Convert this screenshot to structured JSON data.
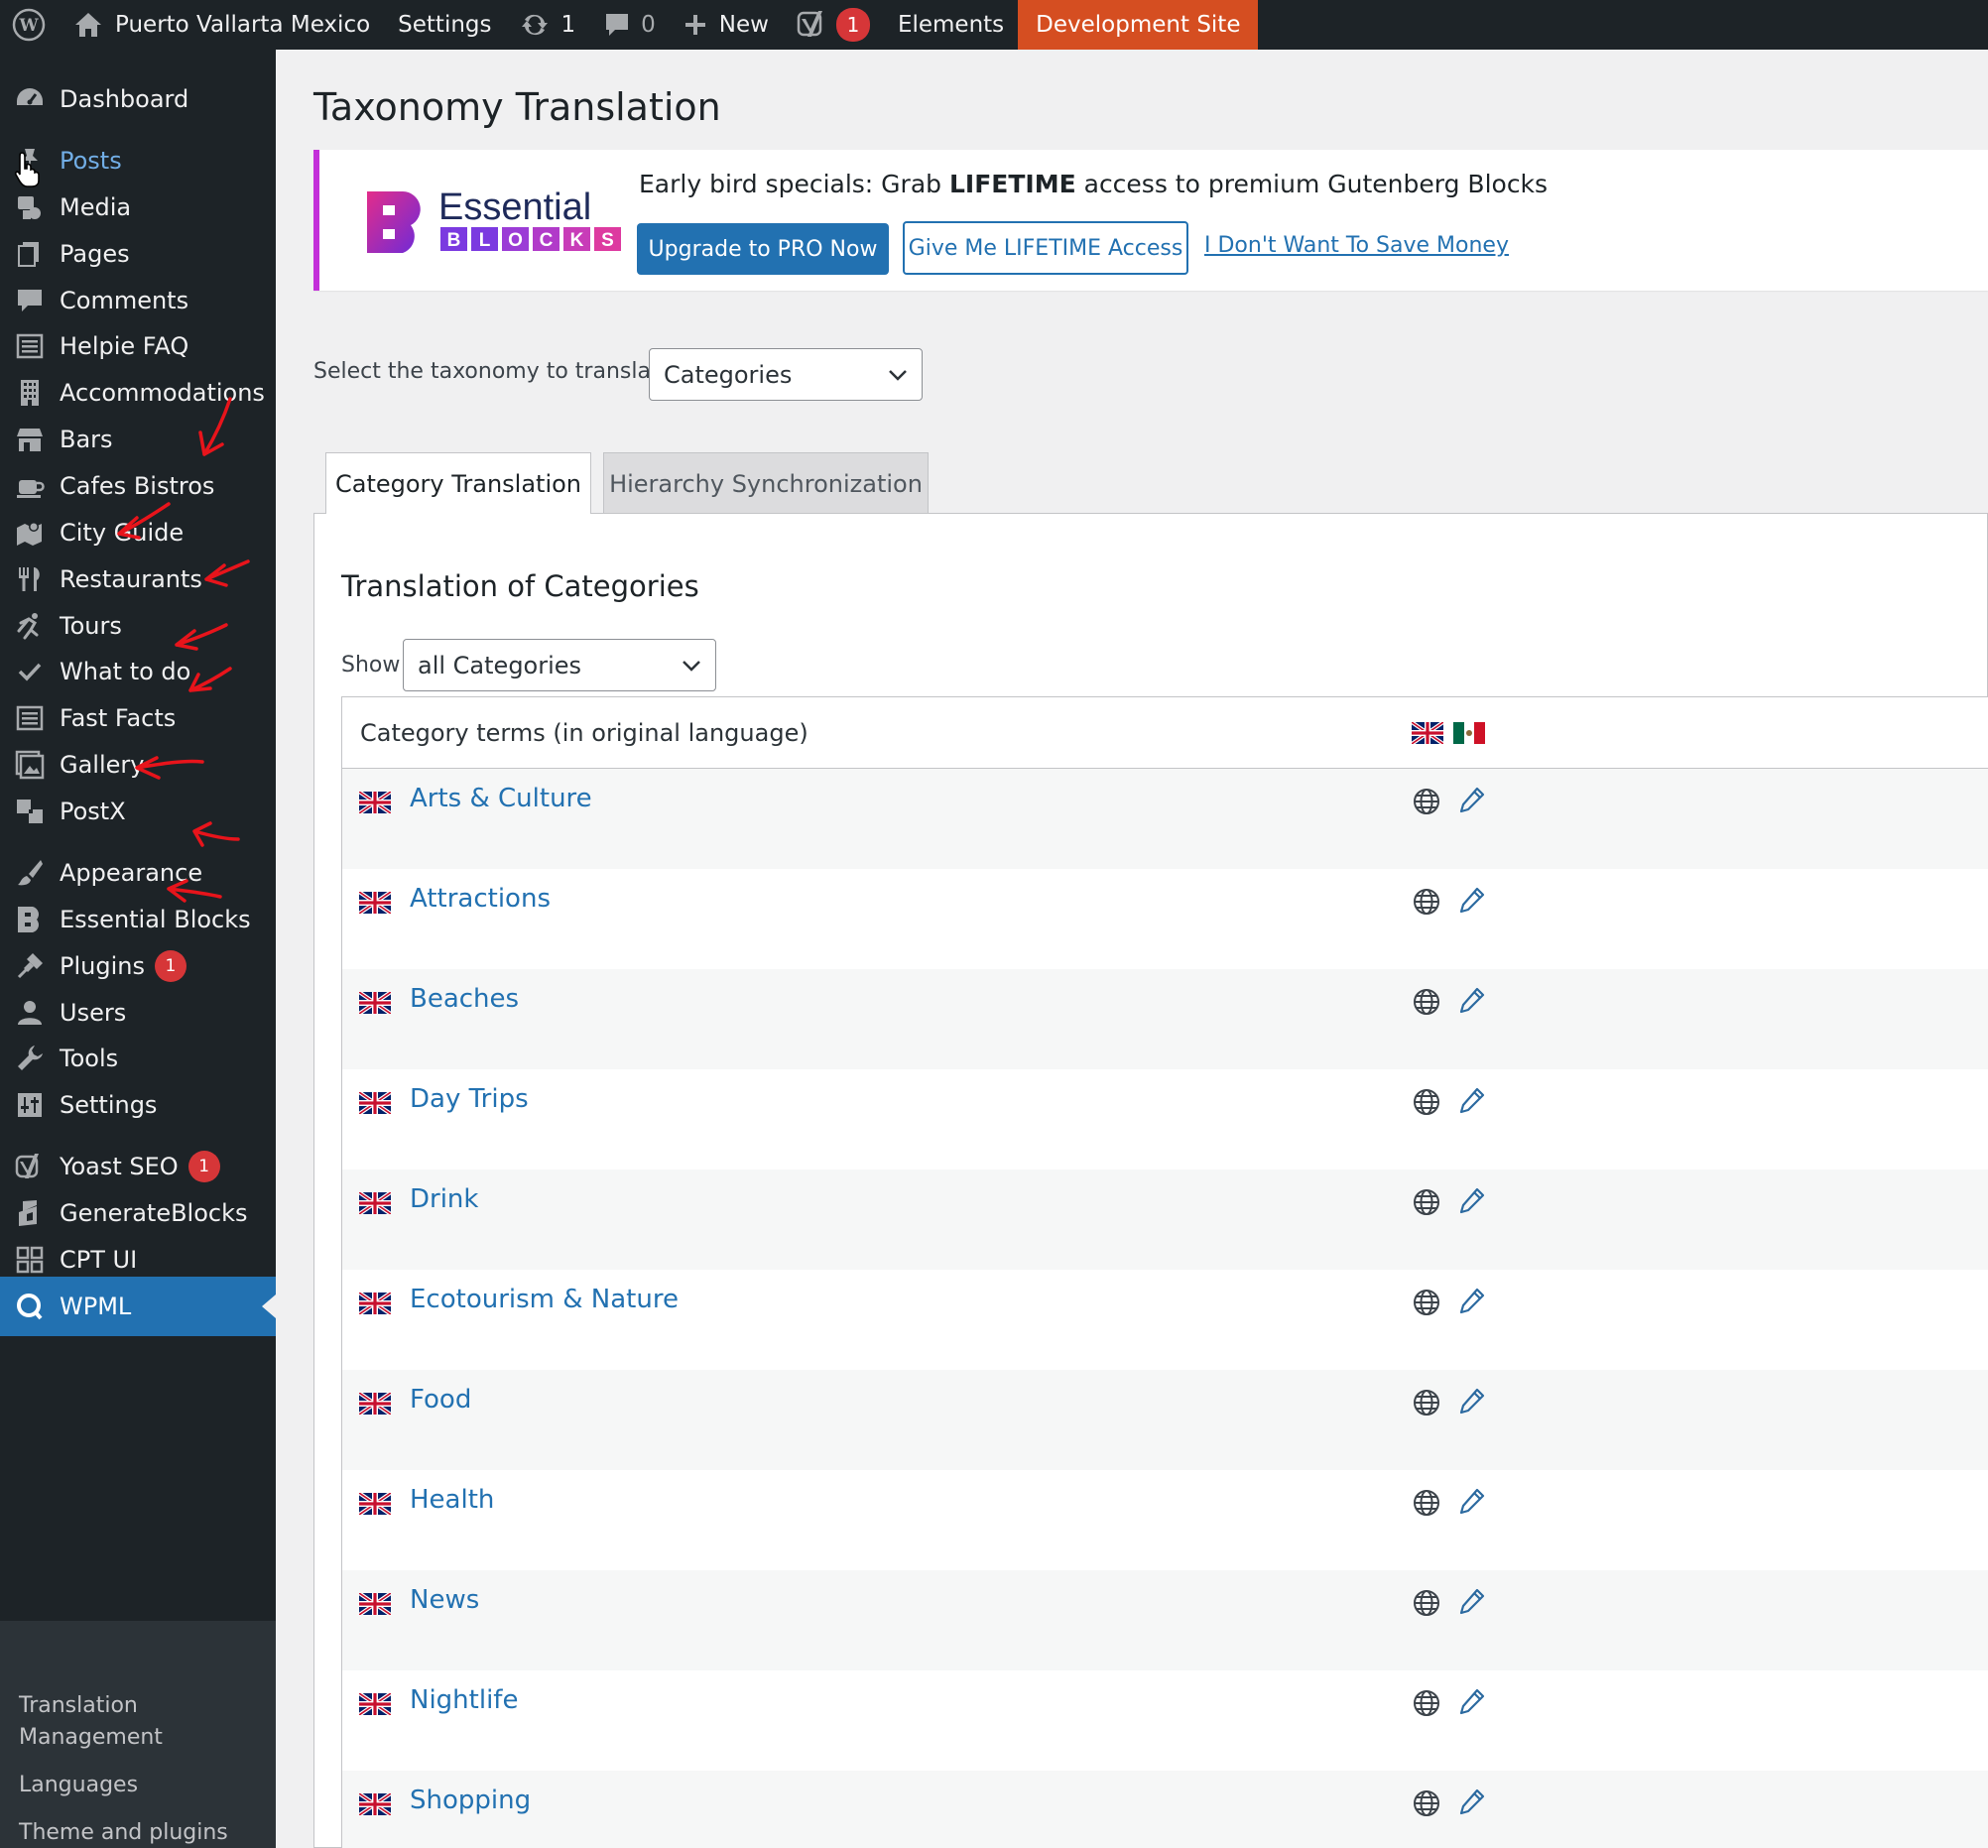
{
  "adminbar": {
    "site_name": "Puerto Vallarta Mexico",
    "settings": "Settings",
    "updates_count": "1",
    "comments_count": "0",
    "new_label": "New",
    "yoast_count": "1",
    "elements": "Elements",
    "dev_site": "Development Site"
  },
  "sidebar": {
    "items": [
      {
        "label": "Dashboard",
        "icon": "dashboard-icon"
      },
      {
        "label": "Posts",
        "icon": "pin-icon"
      },
      {
        "label": "Media",
        "icon": "media-icon"
      },
      {
        "label": "Pages",
        "icon": "pages-icon"
      },
      {
        "label": "Comments",
        "icon": "comment-icon"
      },
      {
        "label": "Helpie FAQ",
        "icon": "list-icon"
      },
      {
        "label": "Accommodations",
        "icon": "building-icon"
      },
      {
        "label": "Bars",
        "icon": "store-icon"
      },
      {
        "label": "Cafes Bistros",
        "icon": "coffee-icon"
      },
      {
        "label": "City Guide",
        "icon": "map-icon"
      },
      {
        "label": "Restaurants",
        "icon": "utensils-icon"
      },
      {
        "label": "Tours",
        "icon": "run-icon"
      },
      {
        "label": "What to do",
        "icon": "check-icon"
      },
      {
        "label": "Fast Facts",
        "icon": "list-icon"
      },
      {
        "label": "Gallery",
        "icon": "gallery-icon"
      },
      {
        "label": "PostX",
        "icon": "postx-icon"
      },
      {
        "label": "Appearance",
        "icon": "brush-icon"
      },
      {
        "label": "Essential Blocks",
        "icon": "essential-blocks-icon"
      },
      {
        "label": "Plugins",
        "icon": "plug-icon",
        "badge": "1"
      },
      {
        "label": "Users",
        "icon": "user-icon"
      },
      {
        "label": "Tools",
        "icon": "wrench-icon"
      },
      {
        "label": "Settings",
        "icon": "sliders-icon"
      },
      {
        "label": "Yoast SEO",
        "icon": "yoast-icon",
        "badge": "1"
      },
      {
        "label": "GenerateBlocks",
        "icon": "generateblocks-icon"
      },
      {
        "label": "CPT UI",
        "icon": "grid-icon"
      },
      {
        "label": "WPML",
        "icon": "wpml-icon"
      }
    ],
    "submenu": [
      "Translation Management",
      "Languages",
      "Theme and plugins"
    ]
  },
  "page": {
    "title": "Taxonomy Translation"
  },
  "notice": {
    "logo_word": "Essential",
    "logo_letters": [
      "B",
      "L",
      "O",
      "C",
      "K",
      "S"
    ],
    "text_before": "Early bird specials: Grab ",
    "text_bold": "LIFETIME",
    "text_after": " access to premium Gutenberg Blocks",
    "btn_upgrade": "Upgrade to PRO Now",
    "btn_lifetime": "Give Me LIFETIME Access",
    "link_dismiss": "I Don't Want To Save Money"
  },
  "taxonomy_select": {
    "label": "Select the taxonomy to translate:",
    "value": "Categories"
  },
  "tabs": [
    {
      "label": "Category Translation"
    },
    {
      "label": "Hierarchy Synchronization"
    }
  ],
  "panel": {
    "heading": "Translation of Categories",
    "show_label": "Show",
    "show_value": "all Categories"
  },
  "table": {
    "header": "Category terms (in original language)",
    "terms": [
      "Arts & Culture",
      "Attractions",
      "Beaches",
      "Day Trips",
      "Drink",
      "Ecotourism & Nature",
      "Food",
      "Health",
      "News",
      "Nightlife",
      "Shopping"
    ]
  },
  "colors": {
    "adminbar_bg": "#1d2327",
    "accent": "#2271b1",
    "dev_site": "#d54e21",
    "badge": "#d63638",
    "notice_border": "#c32fd9"
  }
}
